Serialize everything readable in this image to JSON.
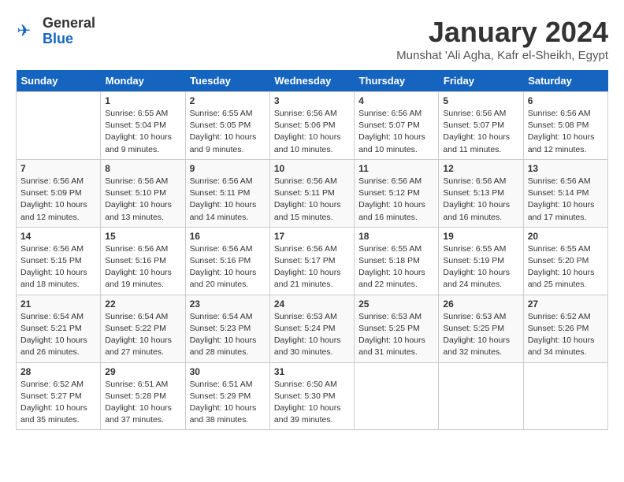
{
  "logo": {
    "general": "General",
    "blue": "Blue"
  },
  "title": "January 2024",
  "location": "Munshat 'Ali Agha, Kafr el-Sheikh, Egypt",
  "weekdays": [
    "Sunday",
    "Monday",
    "Tuesday",
    "Wednesday",
    "Thursday",
    "Friday",
    "Saturday"
  ],
  "rows": [
    [
      {
        "day": "",
        "sunrise": "",
        "sunset": "",
        "daylight": ""
      },
      {
        "day": "1",
        "sunrise": "Sunrise: 6:55 AM",
        "sunset": "Sunset: 5:04 PM",
        "daylight": "Daylight: 10 hours and 9 minutes."
      },
      {
        "day": "2",
        "sunrise": "Sunrise: 6:55 AM",
        "sunset": "Sunset: 5:05 PM",
        "daylight": "Daylight: 10 hours and 9 minutes."
      },
      {
        "day": "3",
        "sunrise": "Sunrise: 6:56 AM",
        "sunset": "Sunset: 5:06 PM",
        "daylight": "Daylight: 10 hours and 10 minutes."
      },
      {
        "day": "4",
        "sunrise": "Sunrise: 6:56 AM",
        "sunset": "Sunset: 5:07 PM",
        "daylight": "Daylight: 10 hours and 10 minutes."
      },
      {
        "day": "5",
        "sunrise": "Sunrise: 6:56 AM",
        "sunset": "Sunset: 5:07 PM",
        "daylight": "Daylight: 10 hours and 11 minutes."
      },
      {
        "day": "6",
        "sunrise": "Sunrise: 6:56 AM",
        "sunset": "Sunset: 5:08 PM",
        "daylight": "Daylight: 10 hours and 12 minutes."
      }
    ],
    [
      {
        "day": "7",
        "sunrise": "Sunrise: 6:56 AM",
        "sunset": "Sunset: 5:09 PM",
        "daylight": "Daylight: 10 hours and 12 minutes."
      },
      {
        "day": "8",
        "sunrise": "Sunrise: 6:56 AM",
        "sunset": "Sunset: 5:10 PM",
        "daylight": "Daylight: 10 hours and 13 minutes."
      },
      {
        "day": "9",
        "sunrise": "Sunrise: 6:56 AM",
        "sunset": "Sunset: 5:11 PM",
        "daylight": "Daylight: 10 hours and 14 minutes."
      },
      {
        "day": "10",
        "sunrise": "Sunrise: 6:56 AM",
        "sunset": "Sunset: 5:11 PM",
        "daylight": "Daylight: 10 hours and 15 minutes."
      },
      {
        "day": "11",
        "sunrise": "Sunrise: 6:56 AM",
        "sunset": "Sunset: 5:12 PM",
        "daylight": "Daylight: 10 hours and 16 minutes."
      },
      {
        "day": "12",
        "sunrise": "Sunrise: 6:56 AM",
        "sunset": "Sunset: 5:13 PM",
        "daylight": "Daylight: 10 hours and 16 minutes."
      },
      {
        "day": "13",
        "sunrise": "Sunrise: 6:56 AM",
        "sunset": "Sunset: 5:14 PM",
        "daylight": "Daylight: 10 hours and 17 minutes."
      }
    ],
    [
      {
        "day": "14",
        "sunrise": "Sunrise: 6:56 AM",
        "sunset": "Sunset: 5:15 PM",
        "daylight": "Daylight: 10 hours and 18 minutes."
      },
      {
        "day": "15",
        "sunrise": "Sunrise: 6:56 AM",
        "sunset": "Sunset: 5:16 PM",
        "daylight": "Daylight: 10 hours and 19 minutes."
      },
      {
        "day": "16",
        "sunrise": "Sunrise: 6:56 AM",
        "sunset": "Sunset: 5:16 PM",
        "daylight": "Daylight: 10 hours and 20 minutes."
      },
      {
        "day": "17",
        "sunrise": "Sunrise: 6:56 AM",
        "sunset": "Sunset: 5:17 PM",
        "daylight": "Daylight: 10 hours and 21 minutes."
      },
      {
        "day": "18",
        "sunrise": "Sunrise: 6:55 AM",
        "sunset": "Sunset: 5:18 PM",
        "daylight": "Daylight: 10 hours and 22 minutes."
      },
      {
        "day": "19",
        "sunrise": "Sunrise: 6:55 AM",
        "sunset": "Sunset: 5:19 PM",
        "daylight": "Daylight: 10 hours and 24 minutes."
      },
      {
        "day": "20",
        "sunrise": "Sunrise: 6:55 AM",
        "sunset": "Sunset: 5:20 PM",
        "daylight": "Daylight: 10 hours and 25 minutes."
      }
    ],
    [
      {
        "day": "21",
        "sunrise": "Sunrise: 6:54 AM",
        "sunset": "Sunset: 5:21 PM",
        "daylight": "Daylight: 10 hours and 26 minutes."
      },
      {
        "day": "22",
        "sunrise": "Sunrise: 6:54 AM",
        "sunset": "Sunset: 5:22 PM",
        "daylight": "Daylight: 10 hours and 27 minutes."
      },
      {
        "day": "23",
        "sunrise": "Sunrise: 6:54 AM",
        "sunset": "Sunset: 5:23 PM",
        "daylight": "Daylight: 10 hours and 28 minutes."
      },
      {
        "day": "24",
        "sunrise": "Sunrise: 6:53 AM",
        "sunset": "Sunset: 5:24 PM",
        "daylight": "Daylight: 10 hours and 30 minutes."
      },
      {
        "day": "25",
        "sunrise": "Sunrise: 6:53 AM",
        "sunset": "Sunset: 5:25 PM",
        "daylight": "Daylight: 10 hours and 31 minutes."
      },
      {
        "day": "26",
        "sunrise": "Sunrise: 6:53 AM",
        "sunset": "Sunset: 5:25 PM",
        "daylight": "Daylight: 10 hours and 32 minutes."
      },
      {
        "day": "27",
        "sunrise": "Sunrise: 6:52 AM",
        "sunset": "Sunset: 5:26 PM",
        "daylight": "Daylight: 10 hours and 34 minutes."
      }
    ],
    [
      {
        "day": "28",
        "sunrise": "Sunrise: 6:52 AM",
        "sunset": "Sunset: 5:27 PM",
        "daylight": "Daylight: 10 hours and 35 minutes."
      },
      {
        "day": "29",
        "sunrise": "Sunrise: 6:51 AM",
        "sunset": "Sunset: 5:28 PM",
        "daylight": "Daylight: 10 hours and 37 minutes."
      },
      {
        "day": "30",
        "sunrise": "Sunrise: 6:51 AM",
        "sunset": "Sunset: 5:29 PM",
        "daylight": "Daylight: 10 hours and 38 minutes."
      },
      {
        "day": "31",
        "sunrise": "Sunrise: 6:50 AM",
        "sunset": "Sunset: 5:30 PM",
        "daylight": "Daylight: 10 hours and 39 minutes."
      },
      {
        "day": "",
        "sunrise": "",
        "sunset": "",
        "daylight": ""
      },
      {
        "day": "",
        "sunrise": "",
        "sunset": "",
        "daylight": ""
      },
      {
        "day": "",
        "sunrise": "",
        "sunset": "",
        "daylight": ""
      }
    ]
  ]
}
